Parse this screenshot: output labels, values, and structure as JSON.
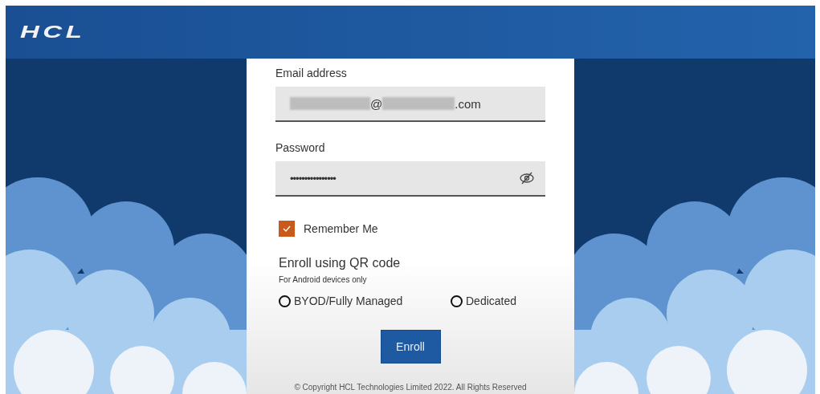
{
  "header": {
    "logo": "HCL"
  },
  "form": {
    "email": {
      "label": "Email address",
      "value_segments": [
        {
          "kind": "redacted"
        },
        {
          "kind": "text",
          "text": "@"
        },
        {
          "kind": "redacted"
        },
        {
          "kind": "text",
          "text": ".com"
        }
      ]
    },
    "password": {
      "label": "Password",
      "value": "••••••••••••••••"
    },
    "remember": {
      "label": "Remember Me",
      "checked": true
    },
    "enroll": {
      "title": "Enroll using QR code",
      "subtitle": "For Android devices only",
      "options": [
        {
          "label": "BYOD/Fully Managed",
          "selected": false
        },
        {
          "label": "Dedicated",
          "selected": false
        }
      ],
      "button": "Enroll"
    },
    "copyright": "© Copyright HCL Technologies Limited 2022. All Rights Reserved"
  }
}
